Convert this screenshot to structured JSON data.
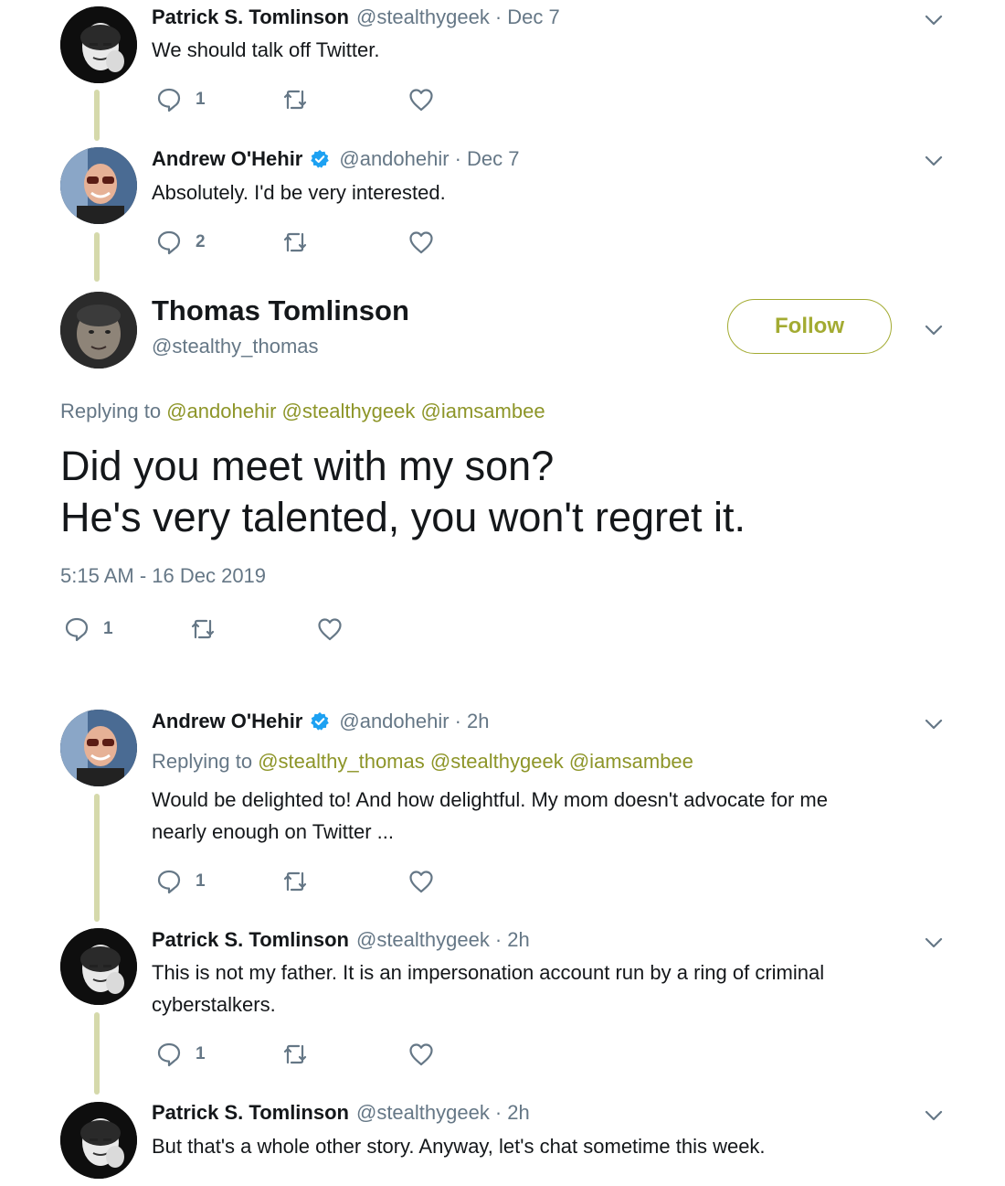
{
  "colors": {
    "accent": "#a3ab32",
    "mention": "#8d9528",
    "thread_line": "#d5d9ab",
    "secondary_text": "#657786",
    "verified": "#1da1f2"
  },
  "tweets": [
    {
      "name": "Patrick S. Tomlinson",
      "handle": "@stealthygeek",
      "time": "· Dec 7",
      "verified": false,
      "text_lines": [
        "We should talk off Twitter."
      ],
      "reply_count": "1"
    },
    {
      "name": "Andrew O'Hehir",
      "handle": "@andohehir",
      "time": "· Dec 7",
      "verified": true,
      "text_lines": [
        "Absolutely. I'd be very interested."
      ],
      "reply_count": "2"
    },
    {
      "name": "Andrew O'Hehir",
      "handle": "@andohehir",
      "time": "· 2h",
      "verified": true,
      "replying_prefix": "Replying to",
      "replying_to": [
        "@stealthy_thomas",
        "@stealthygeek",
        "@iamsambee"
      ],
      "text_lines": [
        "Would be delighted to! And how delightful. My mom doesn't advocate for me",
        "nearly enough on Twitter ..."
      ],
      "reply_count": "1"
    },
    {
      "name": "Patrick S. Tomlinson",
      "handle": "@stealthygeek",
      "time": "· 2h",
      "verified": false,
      "text_lines": [
        "This is not my father. It is an impersonation account run by a ring of criminal",
        "cyberstalkers."
      ],
      "reply_count": "1"
    },
    {
      "name": "Patrick S. Tomlinson",
      "handle": "@stealthygeek",
      "time": "· 2h",
      "verified": false,
      "text_lines": [
        "But that's a whole other story. Anyway, let's chat sometime this week."
      ]
    }
  ],
  "focused": {
    "name": "Thomas Tomlinson",
    "handle": "@stealthy_thomas",
    "follow_label": "Follow",
    "replying_prefix": "Replying to",
    "replying_to": [
      "@andohehir",
      "@stealthygeek",
      "@iamsambee"
    ],
    "text_lines": [
      "Did you meet with my son?",
      "He's very talented, you won't regret it."
    ],
    "timestamp": "5:15 AM - 16 Dec 2019",
    "reply_count": "1"
  },
  "icons": {
    "reply": "reply-icon",
    "retweet": "retweet-icon",
    "like": "heart-icon",
    "caret": "chevron-down-icon",
    "verified": "verified-badge-icon"
  }
}
